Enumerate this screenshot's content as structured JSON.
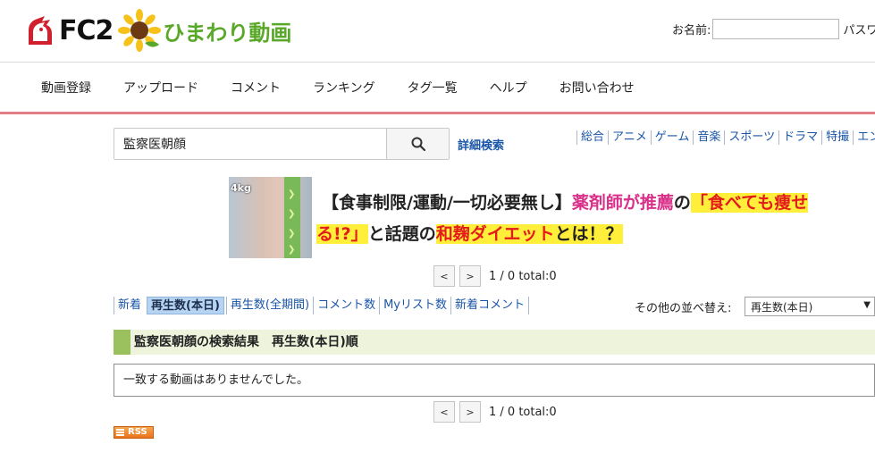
{
  "header": {
    "logo_fc2": "FC2",
    "logo_site": "ひまわり動画",
    "login_name_label": "お名前:",
    "login_name_value": "",
    "login_pass_label": "パスワ"
  },
  "mainnav": {
    "items": [
      "動画登録",
      "アップロード",
      "コメント",
      "ランキング",
      "タグ一覧",
      "ヘルプ",
      "お問い合わせ"
    ]
  },
  "search": {
    "value": "監察医朝顔",
    "advanced_label": "詳細検索"
  },
  "categories": [
    "総合",
    "アニメ",
    "ゲーム",
    "音楽",
    "スポーツ",
    "ドラマ",
    "特撮",
    "エンタ"
  ],
  "banner": {
    "kg_label": "4kg",
    "line1_a": "【食事制限/運動/一切必要無し】",
    "line1_b": "薬剤師が推薦",
    "line1_c": "の",
    "line1_d": "「食べても痩せ",
    "line2_a": "る!?」",
    "line2_b": "と話題の",
    "line2_c": "和麹ダイエット",
    "line2_d": "とは！？"
  },
  "pager": {
    "prev": "<",
    "next": ">",
    "text": "1 / 0 total:0"
  },
  "sort": {
    "tabs": [
      "新着",
      "再生数(本日)",
      "再生数(全期間)",
      "コメント数",
      "Myリスト数",
      "新着コメント"
    ],
    "active_index": 1,
    "other_label": "その他の並べ替え:",
    "select_value": "再生数(本日)"
  },
  "results": {
    "heading": "監察医朝顔の検索結果　再生数(本日)順",
    "empty_message": "一致する動画はありませんでした。"
  },
  "rss": {
    "label": "RSS"
  },
  "colors": {
    "link": "#1a56a8",
    "nav_underline": "#e37e86",
    "heading_bar": "#9bc15f",
    "heading_bg": "#eef4dc",
    "active_tab": "#b6d3f2"
  }
}
